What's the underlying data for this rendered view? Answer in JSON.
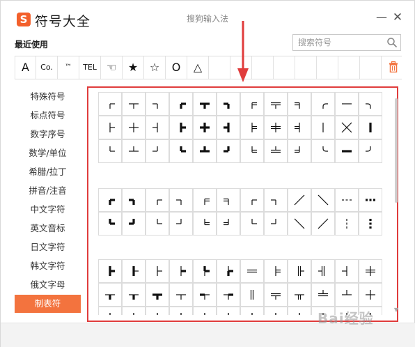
{
  "app": {
    "title": "符号大全",
    "ime_caption": "搜狗输入法",
    "logo_letter": "S",
    "brand_color": "#f3602b"
  },
  "window_controls": {
    "minimize": "—",
    "close": "✕"
  },
  "recent": {
    "label": "最近使用",
    "items": [
      "A",
      "Co.",
      "™",
      "TEL",
      "☜",
      "★",
      "☆",
      "O",
      "△",
      "",
      "",
      "",
      "",
      "",
      "",
      "",
      ""
    ],
    "clear_icon": "trash-icon"
  },
  "search": {
    "placeholder": "搜索符号",
    "icon": "search-icon"
  },
  "sidebar": {
    "items": [
      {
        "label": "特殊符号",
        "active": false
      },
      {
        "label": "标点符号",
        "active": false
      },
      {
        "label": "数字序号",
        "active": false
      },
      {
        "label": "数学/单位",
        "active": false
      },
      {
        "label": "希腊/拉丁",
        "active": false
      },
      {
        "label": "拼音/注音",
        "active": false
      },
      {
        "label": "中文字符",
        "active": false
      },
      {
        "label": "英文音标",
        "active": false
      },
      {
        "label": "日文字符",
        "active": false
      },
      {
        "label": "韩文字符",
        "active": false
      },
      {
        "label": "俄文字母",
        "active": false
      },
      {
        "label": "制表符",
        "active": true
      }
    ],
    "active_color": "#f3733e"
  },
  "symbol_groups": {
    "group1_row1": [
      "┌",
      "┬",
      "┐",
      "┏",
      "┳",
      "┓",
      "╒",
      "╤",
      "╕",
      "╭",
      "─",
      "╮"
    ],
    "group1_row2": [
      "├",
      "┼",
      "┤",
      "┣",
      "╋",
      "┫",
      "╞",
      "╪",
      "╡",
      "│",
      "╳",
      "┃"
    ],
    "group1_row3": [
      "└",
      "┴",
      "┘",
      "┗",
      "┻",
      "┛",
      "╘",
      "╧",
      "╛",
      "╰",
      "━",
      "╯"
    ],
    "group2_row1": [
      "┏",
      "┓",
      "┌",
      "┐",
      "╒",
      "╕",
      "┌",
      "┐",
      "╱",
      "╲",
      "┄",
      "┅"
    ],
    "group2_row2": [
      "┗",
      "┛",
      "└",
      "┘",
      "╘",
      "╛",
      "└",
      "┘",
      "╲",
      "╱",
      "┆",
      "┇"
    ],
    "group3_row1": [
      "┣",
      "┠",
      "├",
      "┝",
      "┡",
      "┢",
      "═",
      "╞",
      "╟",
      "╢",
      "┤",
      "╪"
    ],
    "group3_row2": [
      "┯",
      "┰",
      "┳",
      "┬",
      "┭",
      "┮",
      "║",
      "╤",
      "╥",
      "╧",
      "┴",
      "┼"
    ]
  },
  "highlight_color": "#e03c3c",
  "watermark": "Bai经验"
}
